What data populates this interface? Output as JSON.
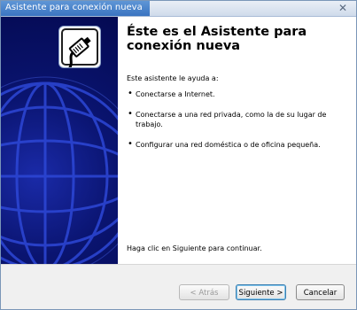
{
  "window": {
    "title": "Asistente para conexión nueva"
  },
  "header": {
    "heading": "Éste es el Asistente para conexión nueva"
  },
  "body": {
    "intro": "Este asistente le ayuda a:",
    "items": [
      "Conectarse a Internet.",
      "Conectarse a una red privada, como la de su lugar de trabajo.",
      "Configurar una red doméstica o de oficina pequeña."
    ],
    "footer": "Haga clic en Siguiente para continuar."
  },
  "buttons": {
    "back": "< Atrás",
    "next": "Siguiente >",
    "cancel": "Cancelar"
  },
  "icons": {
    "side_logo": "network-cable-icon",
    "globe": "globe-icon",
    "close": "close-icon"
  },
  "colors": {
    "side_panel": "#0a1470",
    "title_highlight": "#3a74c1"
  }
}
